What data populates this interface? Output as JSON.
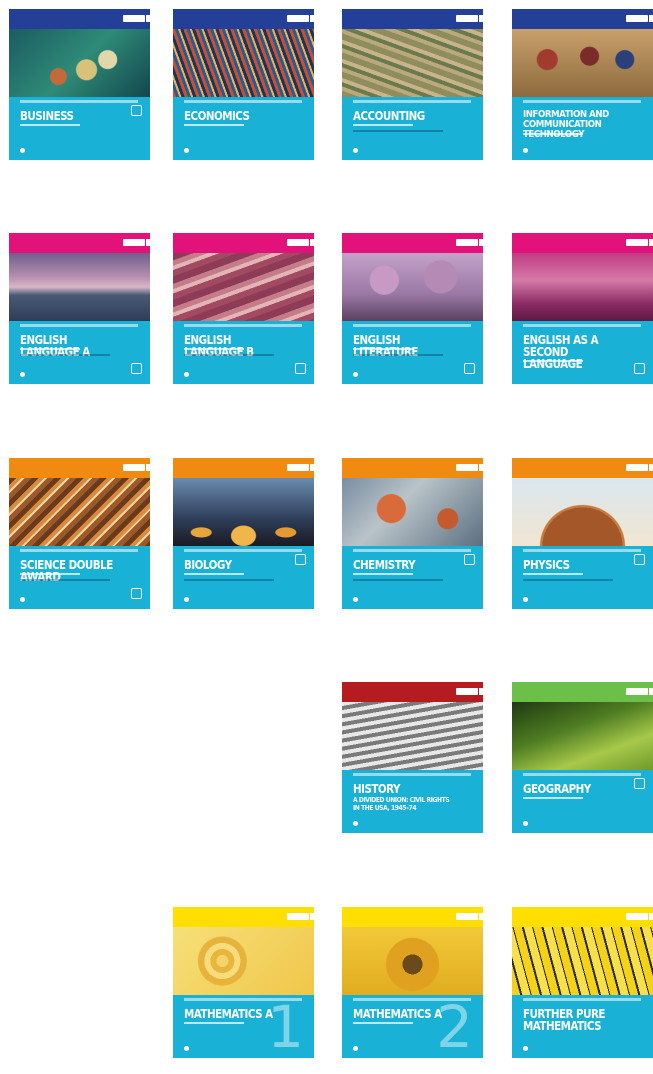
{
  "books": [
    {
      "title": "BUSINESS"
    },
    {
      "title": "ECONOMICS"
    },
    {
      "title": "ACCOUNTING"
    },
    {
      "title": "INFORMATION AND COMMUNICATION TECHNOLOGY"
    },
    {
      "title": "ENGLISH LANGUAGE A"
    },
    {
      "title": "ENGLISH LANGUAGE B"
    },
    {
      "title": "ENGLISH LITERATURE"
    },
    {
      "title": "ENGLISH AS A SECOND LANGUAGE"
    },
    {
      "title": "SCIENCE DOUBLE AWARD"
    },
    {
      "title": "BIOLOGY"
    },
    {
      "title": "CHEMISTRY"
    },
    {
      "title": "PHYSICS"
    },
    {
      "title": "HISTORY",
      "subtitle": "A DIVIDED UNION: CIVIL RIGHTS IN THE USA, 1945–74"
    },
    {
      "title": "GEOGRAPHY"
    },
    {
      "title": "MATHEMATICS A",
      "number": "1"
    },
    {
      "title": "MATHEMATICS A",
      "number": "2"
    },
    {
      "title": "FURTHER PURE MATHEMATICS"
    }
  ],
  "colors": {
    "business_band": "#233f97",
    "english_band": "#e2127a",
    "science_band": "#f08a10",
    "history_band": "#b41c1f",
    "geography_band": "#6cc04a",
    "maths_band": "#ffde00",
    "teal": "#19b1d5"
  }
}
